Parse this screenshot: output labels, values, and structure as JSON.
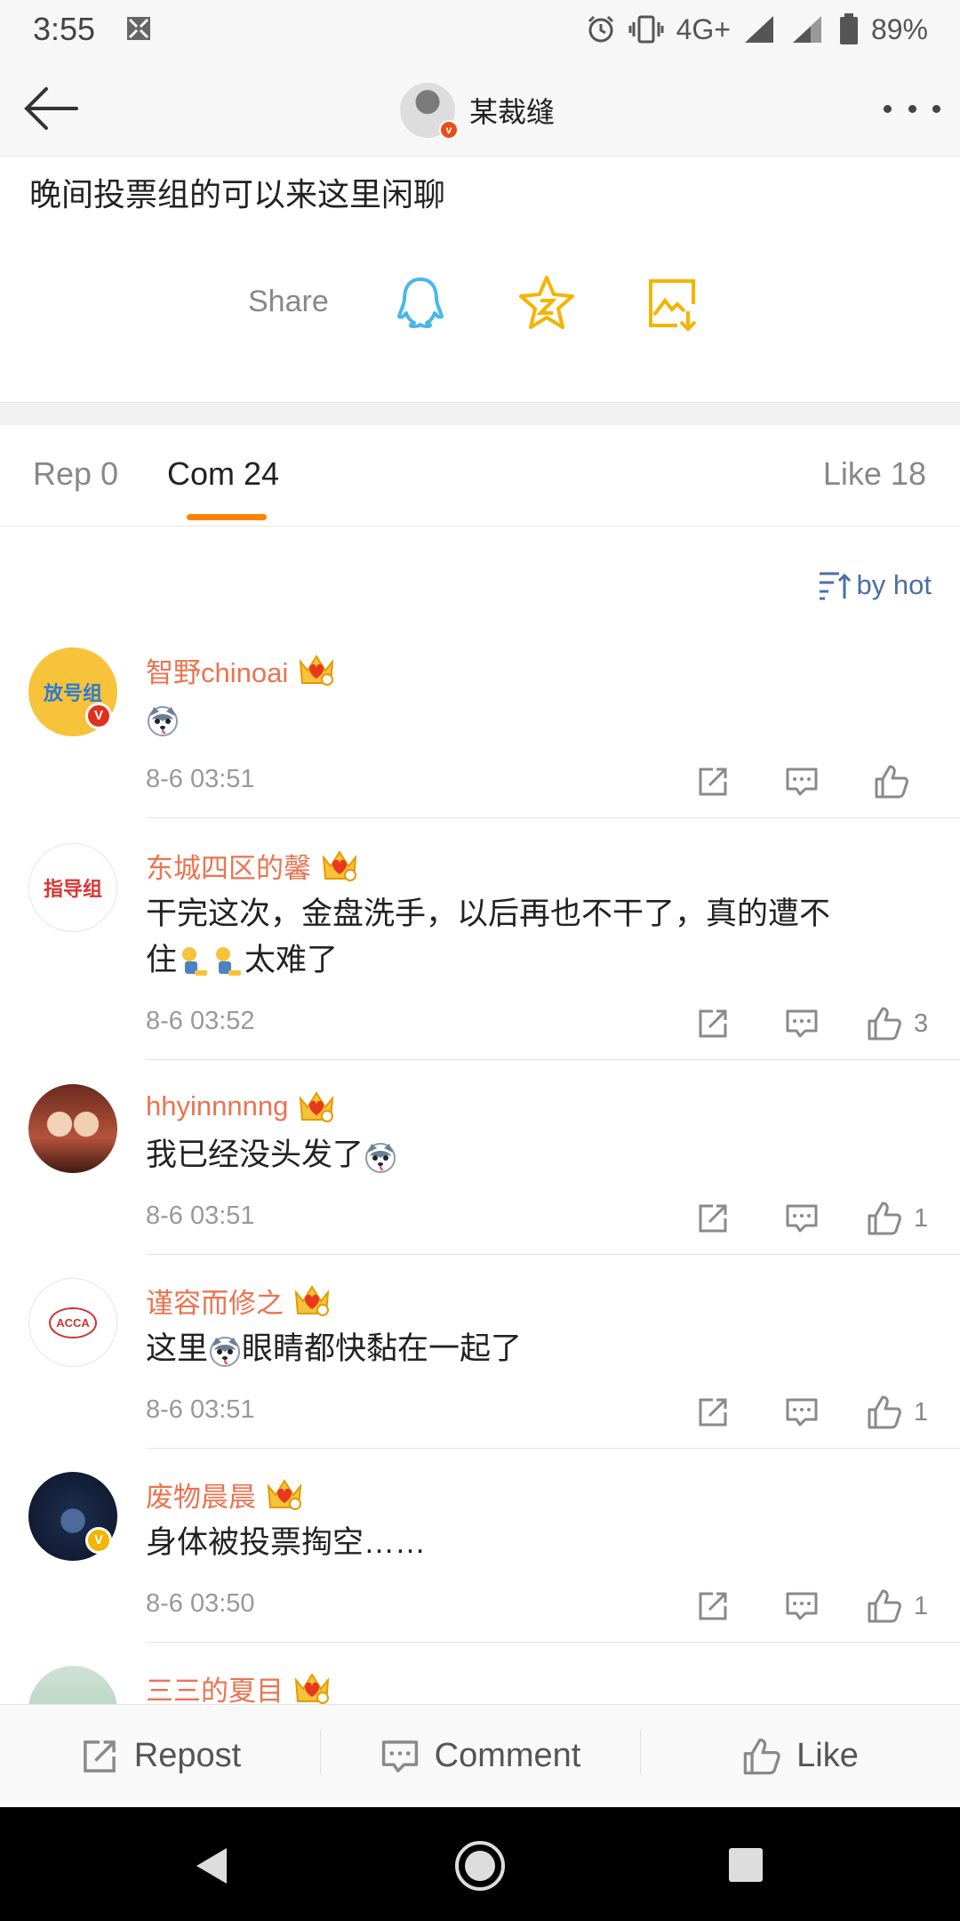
{
  "status": {
    "time": "3:55",
    "network": "4G+",
    "battery": "89%"
  },
  "header": {
    "title": "某裁缝"
  },
  "post": {
    "text": "晚间投票组的可以来这里闲聊",
    "share_label": "Share"
  },
  "tabs": [
    {
      "label": "Rep 0"
    },
    {
      "label": "Com 24"
    },
    {
      "label": "Like 18"
    }
  ],
  "sort_label": "by hot",
  "comments": [
    {
      "name": "智野chinoai",
      "avatar_text": "放号组",
      "text": "",
      "time": "8-6 03:51",
      "likes": ""
    },
    {
      "name": "东城四区的馨",
      "avatar_text": "指导组",
      "text_line1": "干完这次，金盘洗手，以后再也不干了，真的遭不",
      "text_line2": "太难了",
      "text_line2_prefix": "住",
      "time": "8-6 03:52",
      "likes": "3"
    },
    {
      "name": "hhyinnnnng",
      "text": "我已经没头发了",
      "time": "8-6 03:51",
      "likes": "1"
    },
    {
      "name": "谨容而修之",
      "avatar_text": "ACCA",
      "text_pre": "这里",
      "text_post": "眼睛都快黏在一起了",
      "time": "8-6 03:51",
      "likes": "1"
    },
    {
      "name": "废物晨晨",
      "text": "身体被投票掏空……",
      "time": "8-6 03:50",
      "likes": "1"
    },
    {
      "name": "三三的夏目"
    }
  ],
  "bottom_bar": {
    "repost": "Repost",
    "comment": "Comment",
    "like": "Like"
  },
  "colors": {
    "accent": "#ff8200",
    "username": "#eb7350",
    "link": "#4a6fa5"
  }
}
